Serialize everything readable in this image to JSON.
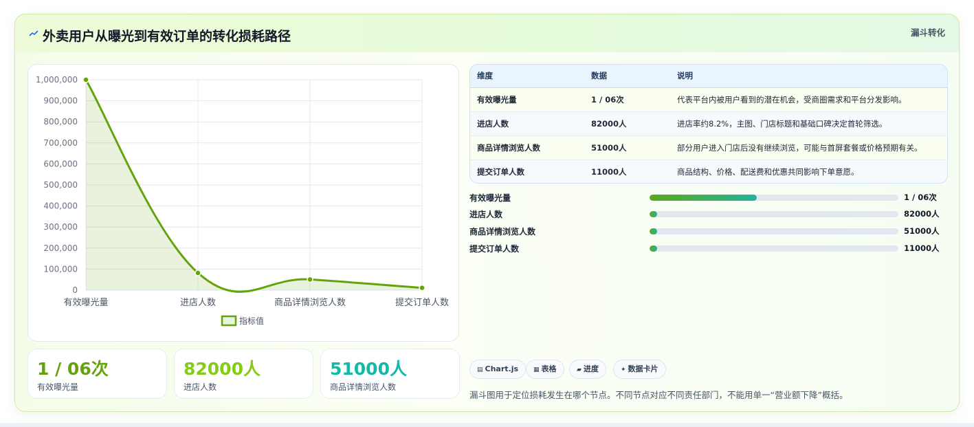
{
  "header": {
    "title": "外卖用户从曝光到有效订单的转化损耗路径",
    "tag": "漏斗转化",
    "icon": "trend-line-icon"
  },
  "chart_data": {
    "type": "line",
    "categories": [
      "有效曝光量",
      "进店人数",
      "商品详情浏览人数",
      "提交订单人数"
    ],
    "series": [
      {
        "name": "指标值",
        "values": [
          1000000,
          82000,
          51000,
          11000
        ]
      }
    ],
    "ylim": [
      0,
      1000000
    ],
    "yticks": [
      "0",
      "100,000",
      "200,000",
      "300,000",
      "400,000",
      "500,000",
      "600,000",
      "700,000",
      "800,000",
      "900,000",
      "1,000,000"
    ],
    "grid": true,
    "legend_position": "bottom",
    "fill": true,
    "color": "#65a30d"
  },
  "kpis": [
    {
      "value": "1 / 06次",
      "label": "有效曝光量",
      "color": "#65a30d"
    },
    {
      "value": "82000人",
      "label": "进店人数",
      "color": "#84cc16"
    },
    {
      "value": "51000人",
      "label": "商品详情浏览人数",
      "color": "#14b8a6"
    }
  ],
  "table": {
    "headers": [
      "维度",
      "数据",
      "说明"
    ],
    "rows": [
      [
        "有效曝光量",
        "1 / 06次",
        "代表平台内被用户看到的潜在机会，受商圈需求和平台分发影响。"
      ],
      [
        "进店人数",
        "82000人",
        "进店率约8.2%，主图、门店标题和基础口碑决定首轮筛选。"
      ],
      [
        "商品详情浏览人数",
        "51000人",
        "部分用户进入门店后没有继续浏览，可能与首屏套餐或价格预期有关。"
      ],
      [
        "提交订单人数",
        "11000人",
        "商品结构、价格、配送费和优惠共同影响下单意愿。"
      ]
    ]
  },
  "progress": [
    {
      "label": "有效曝光量",
      "value": "1 / 06次",
      "fraction": 0.43
    },
    {
      "label": "进店人数",
      "value": "82000人",
      "fraction": 0.03
    },
    {
      "label": "商品详情浏览人数",
      "value": "51000人",
      "fraction": 0.03
    },
    {
      "label": "提交订单人数",
      "value": "11000人",
      "fraction": 0.03
    }
  ],
  "chips": [
    {
      "icon": "▤",
      "label": "Chart.js"
    },
    {
      "icon": "▦",
      "label": "表格"
    },
    {
      "icon": "▰",
      "label": "进度"
    },
    {
      "icon": "✦",
      "label": "数据卡片"
    }
  ],
  "footnote": "漏斗图用于定位损耗发生在哪个节点。不同节点对应不同责任部门，不能用单一“营业额下降”概括。"
}
